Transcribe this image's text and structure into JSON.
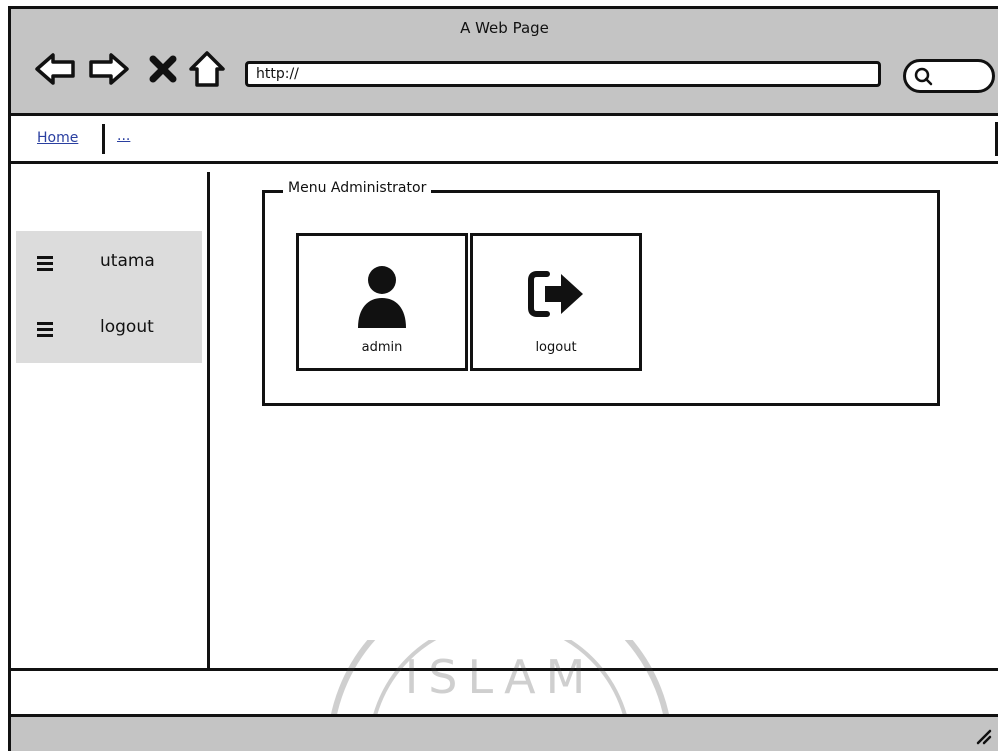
{
  "window": {
    "title": "A Web Page"
  },
  "browser": {
    "url": "http://",
    "icons": [
      "back-arrow-icon",
      "forward-arrow-icon",
      "close-x-icon",
      "home-icon",
      "search-icon"
    ]
  },
  "breadcrumb": {
    "home": "Home",
    "more": "..."
  },
  "sidebar": {
    "items": [
      {
        "label": "utama",
        "icon": "hamburger-menu-icon"
      },
      {
        "label": "logout",
        "icon": "hamburger-menu-icon"
      }
    ]
  },
  "main": {
    "group_title": "Menu Administrator",
    "tiles": [
      {
        "label": "admin",
        "icon": "user-icon"
      },
      {
        "label": "logout",
        "icon": "sign-out-icon"
      }
    ]
  },
  "watermark": {
    "text": "ISLAM"
  },
  "colors": {
    "chrome": "#c4c4c4",
    "sidebar_bg": "#dcdcdc",
    "link": "#2a3fa0"
  }
}
